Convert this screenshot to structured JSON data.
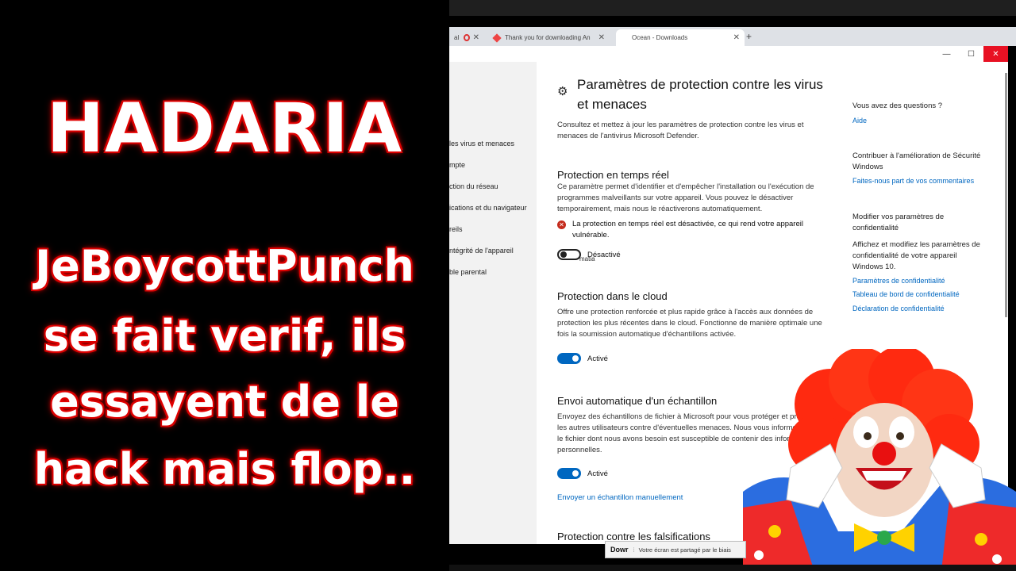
{
  "overlay": {
    "title": "HADARIA",
    "line1": "JeBoycottPunch",
    "line2": "se fait verif, ils",
    "line3": "essayent de le",
    "line4": "hack mais flop.."
  },
  "browser": {
    "tab_a": "al",
    "tab_b": "Thank you for downloading An",
    "tab_c": "Ocean - Downloads",
    "new_tab": "+"
  },
  "window_controls": {
    "minimize": "—",
    "maximize": "☐",
    "close": "✕"
  },
  "sidebar": {
    "items": [
      "les virus et menaces",
      "mpte",
      "ction du réseau",
      "ications et du navigateur",
      "reils",
      "ntégrité de l'appareil",
      "ble parental"
    ]
  },
  "main": {
    "title": "Paramètres de protection contre les virus et menaces",
    "intro": "Consultez et mettez à jour les paramètres de protection contre les virus et menaces de l'antivirus Microsoft Defender.",
    "realtime": {
      "heading": "Protection en temps réel",
      "desc": "Ce paramètre permet d'identifier et d'empêcher l'installation ou l'exécution de programmes malveillants sur votre appareil. Vous pouvez le désactiver temporairement, mais nous le réactiverons automatiquement.",
      "warning": "La protection en temps réel est désactivée, ce qui rend votre appareil vulnérable.",
      "toggle_label": "Désactivé",
      "toggle_state": "off",
      "tooltip": "matia"
    },
    "cloud": {
      "heading": "Protection dans le cloud",
      "desc": "Offre une protection renforcée et plus rapide grâce à l'accès aux données de protection les plus récentes dans le cloud. Fonctionne de manière optimale une fois la soumission automatique d'échantillons activée.",
      "toggle_label": "Activé",
      "toggle_state": "on"
    },
    "sample": {
      "heading": "Envoi automatique d'un échantillon",
      "desc": "Envoyez des échantillons de fichier à Microsoft pour vous protéger et protéger les autres utilisateurs contre d'éventuelles menaces. Nous vous informerons si le fichier dont nous avons besoin est susceptible de contenir des informations personnelles.",
      "toggle_label": "Activé",
      "toggle_state": "on",
      "link": "Envoyer un échantillon manuellement"
    },
    "tamper": {
      "heading": "Protection contre les falsifications"
    }
  },
  "right": {
    "q_heading": "Vous avez des questions ?",
    "help_link": "Aide",
    "contrib_heading": "Contribuer à l'amélioration de Sécurité Windows",
    "feedback_link": "Faites-nous part de vos commentaires",
    "privacy_heading": "Modifier vos paramètres de confidentialité",
    "privacy_desc": "Affichez et modifiez les paramètres de confidentialité de votre appareil Windows 10.",
    "privacy_link1": "Paramètres de confidentialité",
    "privacy_link2": "Tableau de bord de confidentialité",
    "privacy_link3": "Déclaration de confidentialité"
  },
  "share_bar": {
    "download": "Dowr",
    "message": "Votre écran est partagé par le biais"
  },
  "colors": {
    "accent": "#0067c0",
    "error": "#c42b1c",
    "close_hover": "#e81123",
    "overlay_glow": "#e00000"
  }
}
